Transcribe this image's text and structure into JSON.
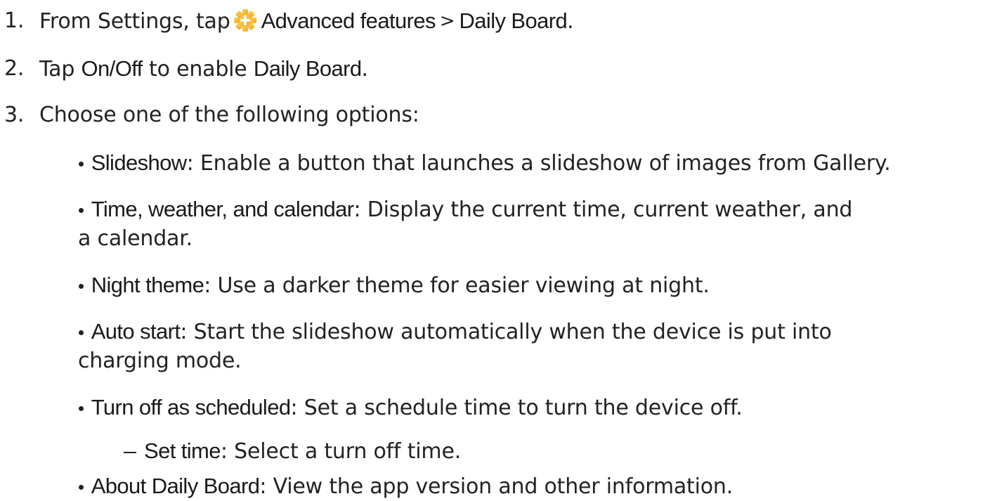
{
  "steps": [
    {
      "number": "1.",
      "pre": "From Settings, tap",
      "icon": "advanced-features-gear-icon",
      "term1": "Advanced features",
      "separator": ">",
      "term2": "Daily Board",
      "post": "."
    },
    {
      "number": "2.",
      "pre": "Tap ",
      "term1": "On/Off",
      "mid": " to enable ",
      "term2": "Daily Board",
      "post": "."
    },
    {
      "number": "3.",
      "text": "Choose one of the following options:"
    }
  ],
  "options": [
    {
      "term": "Slideshow",
      "desc": ": Enable a button that launches a slideshow of images from Gallery."
    },
    {
      "term": "Time, weather, and calendar",
      "desc": ": Display the current time, current weather, and",
      "desc_cont": "a calendar."
    },
    {
      "term": "Night theme",
      "desc": ": Use a darker theme for easier viewing at night."
    },
    {
      "term": "Auto start",
      "desc": ": Start the slideshow automatically when the device is put into",
      "desc_cont": "charging mode."
    },
    {
      "term": "Turn off as scheduled",
      "desc": ": Set a schedule time to turn the device off."
    },
    {
      "term": "About Daily Board",
      "desc": ": View the app version and other information."
    }
  ],
  "sub_options": [
    {
      "term": "Set time",
      "desc": ": Select a turn off time."
    }
  ],
  "colors": {
    "text": "#222222",
    "icon_orange": "#F5A623",
    "icon_yellow": "#FFD24D"
  }
}
